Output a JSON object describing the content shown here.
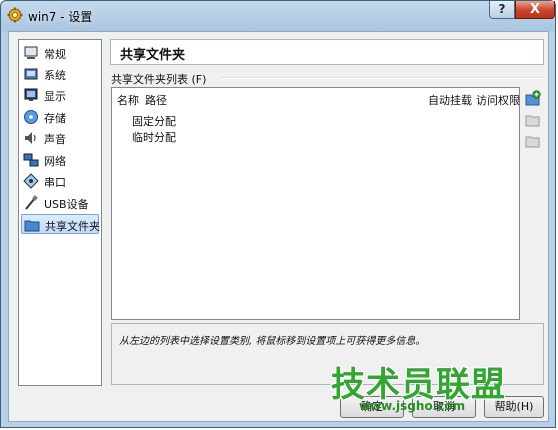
{
  "window": {
    "title": "win7 - 设置",
    "help": "?",
    "close": "X"
  },
  "sidebar": {
    "items": [
      {
        "label": "常规",
        "icon": "general-icon"
      },
      {
        "label": "系统",
        "icon": "system-icon"
      },
      {
        "label": "显示",
        "icon": "display-icon"
      },
      {
        "label": "存储",
        "icon": "storage-icon"
      },
      {
        "label": "声音",
        "icon": "audio-icon"
      },
      {
        "label": "网络",
        "icon": "network-icon"
      },
      {
        "label": "串口",
        "icon": "serial-port-icon"
      },
      {
        "label": "USB设备",
        "icon": "usb-icon"
      },
      {
        "label": "共享文件夹",
        "icon": "shared-folder-icon",
        "selected": true
      }
    ]
  },
  "page": {
    "title": "共享文件夹",
    "section_label": "共享文件夹列表 (F)",
    "columns": {
      "name": "名称",
      "path": "路径",
      "auto_mount": "自动挂载",
      "access": "访问权限"
    },
    "rows": [
      "固定分配",
      "临时分配"
    ],
    "info": "从左边的列表中选择设置类别, 将鼠标移到设置项上可获得更多信息。"
  },
  "buttons": {
    "ok": "确定",
    "cancel": "取消",
    "help": "帮助(H)"
  },
  "watermark": {
    "title": "技术员联盟",
    "url": "www.jsgho.com"
  }
}
